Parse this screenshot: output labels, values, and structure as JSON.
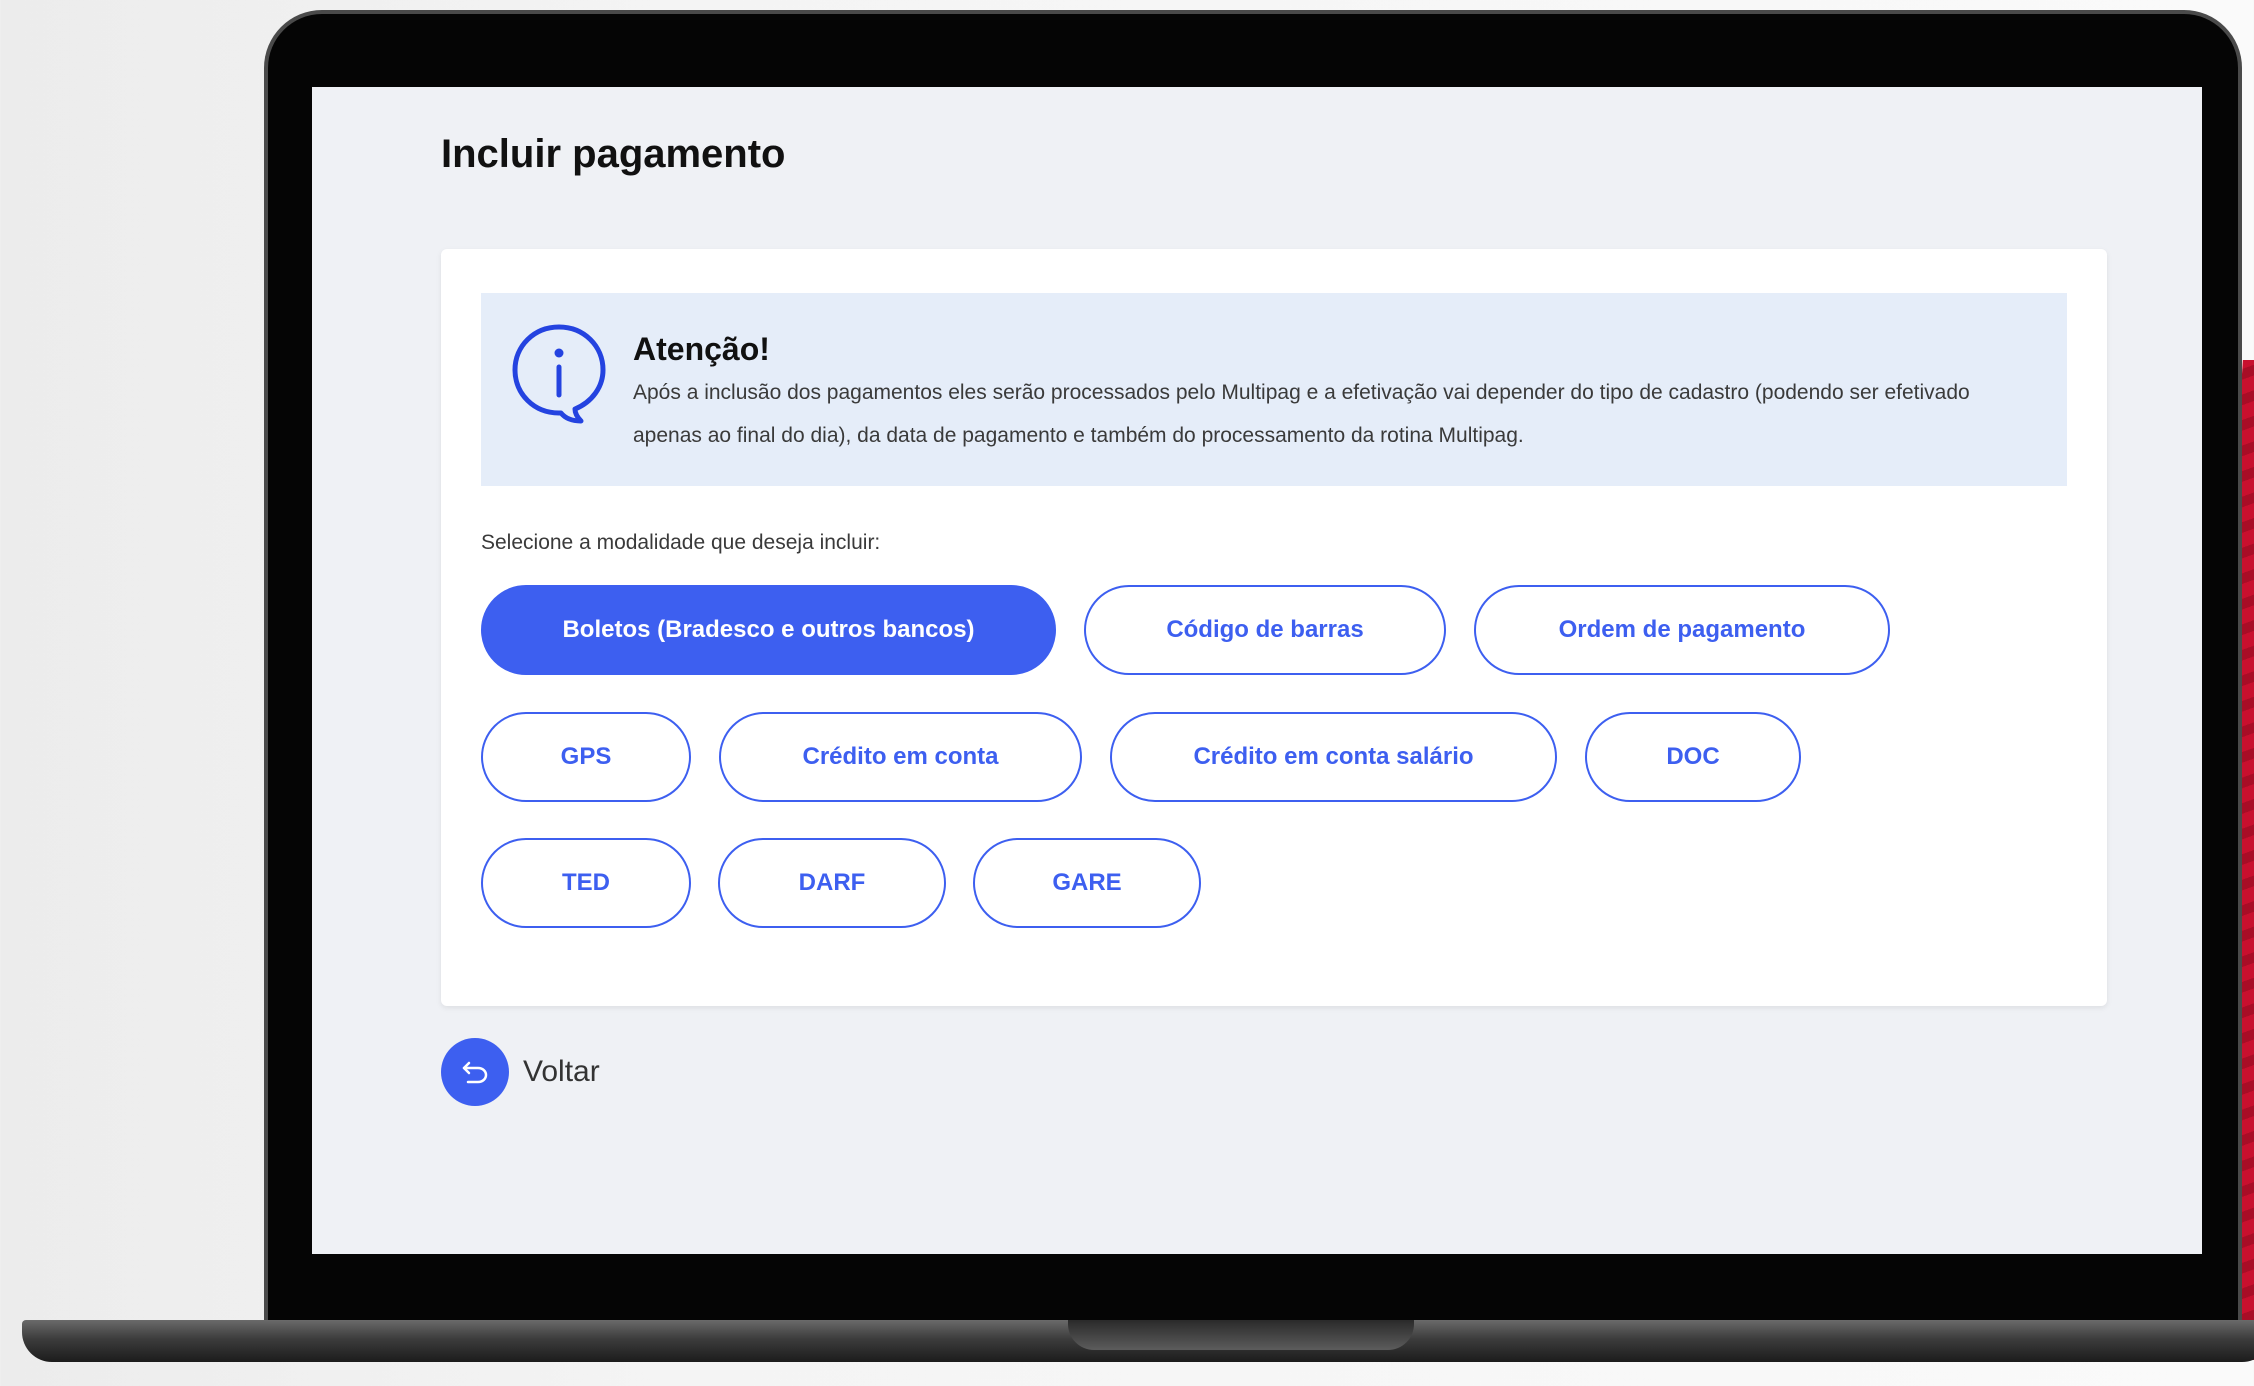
{
  "page": {
    "title": "Incluir pagamento"
  },
  "alert": {
    "title": "Atenção!",
    "text": "Após a inclusão dos pagamentos eles serão processados pelo Multipag e a efetivação vai depender do tipo de cadastro (podendo ser efetivado apenas ao final do dia), da data de pagamento e também do processamento da rotina Multipag.",
    "icon": "info-speech-bubble-icon"
  },
  "selection": {
    "label": "Selecione a modalidade que deseja incluir:",
    "selected": "Boletos (Bradesco e outros bancos)",
    "options": [
      "Boletos (Bradesco e outros bancos)",
      "Código de barras",
      "Ordem de pagamento",
      "GPS",
      "Crédito em conta",
      "Crédito em conta salário",
      "DOC",
      "TED",
      "DARF",
      "GARE"
    ]
  },
  "back": {
    "label": "Voltar",
    "icon": "undo-arrow-icon"
  },
  "colors": {
    "accent": "#3d5ff0",
    "alert_bg": "#e5edf9",
    "screen_bg": "#eff1f5",
    "brand_red": "#c8102e"
  }
}
